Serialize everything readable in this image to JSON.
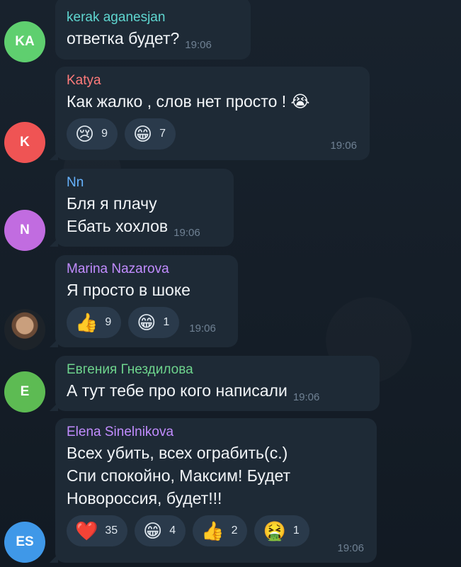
{
  "messages": [
    {
      "name": "kerak aganesjan",
      "name_color": "#5fd6d0",
      "avatar_initials": "KA",
      "avatar_color": "#5fcf6f",
      "text": [
        "ответка будет?"
      ],
      "time": "19:06",
      "reactions": []
    },
    {
      "name": "Katya",
      "name_color": "#ff7b7b",
      "avatar_initials": "K",
      "avatar_color": "#ef5454",
      "text": [
        "Как жалко , слов нет просто ! 😭"
      ],
      "time": "19:06",
      "reactions": [
        {
          "emoji": "😢",
          "count": "9"
        },
        {
          "emoji": "😁",
          "count": "7"
        }
      ]
    },
    {
      "name": "Nn",
      "name_color": "#66b3ff",
      "avatar_initials": "N",
      "avatar_color": "#c16ce0",
      "text": [
        "Бля я плачу",
        "Ебать хохлов"
      ],
      "time": "19:06",
      "reactions": []
    },
    {
      "name": "Marina Nazarova",
      "name_color": "#c18cff",
      "avatar_initials": "",
      "avatar_color": "#1d2329",
      "text": [
        "Я просто в шоке"
      ],
      "time": "19:06",
      "reactions": [
        {
          "emoji": "👍",
          "count": "9"
        },
        {
          "emoji": "😁",
          "count": "1"
        }
      ]
    },
    {
      "name": "Евгения Гнездилова",
      "name_color": "#6ed48d",
      "avatar_initials": "E",
      "avatar_color": "#5dbb53",
      "text": [
        "А тут тебе про кого написали"
      ],
      "time": "19:06",
      "reactions": []
    },
    {
      "name": "Elena Sinelnikova",
      "name_color": "#c18cff",
      "avatar_initials": "ES",
      "avatar_color": "#3f98e8",
      "text": [
        "Всех убить, всех ограбить(с.)",
        "Спи спокойно, Максим! Будет",
        "Новороссия, будет!!!"
      ],
      "time": "19:06",
      "reactions": [
        {
          "emoji": "❤️",
          "count": "35"
        },
        {
          "emoji": "😁",
          "count": "4"
        },
        {
          "emoji": "👍",
          "count": "2"
        },
        {
          "emoji": "🤮",
          "count": "1"
        }
      ]
    }
  ]
}
